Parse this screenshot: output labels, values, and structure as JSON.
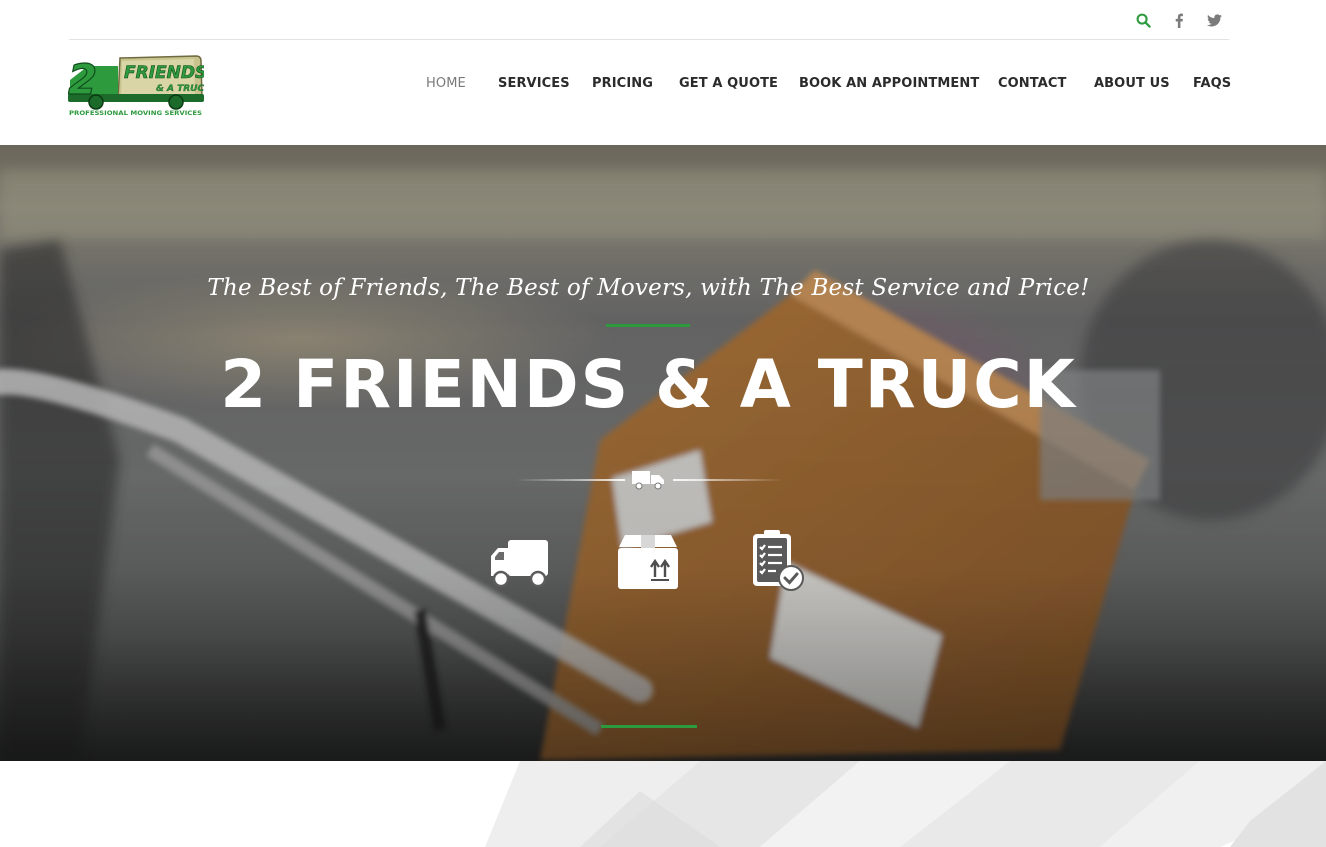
{
  "brand": {
    "logo_alt": "2 Friends & A Truck - Professional Moving Services",
    "logo_number": "2",
    "logo_word": "FRIENDS",
    "logo_sub": "& A TRUCK",
    "logo_tagline": "PROFESSIONAL MOVING SERVICES",
    "color_green": "#2e9a3e",
    "color_dark_green": "#1c6b2a"
  },
  "topbar": {
    "icons": [
      "search-icon",
      "facebook-icon",
      "twitter-icon"
    ]
  },
  "nav": {
    "items": [
      {
        "label": "HOME",
        "active": true
      },
      {
        "label": "SERVICES",
        "active": false
      },
      {
        "label": "PRICING",
        "active": false
      },
      {
        "label": "GET A QUOTE",
        "active": false
      },
      {
        "label": "BOOK AN APPOINTMENT",
        "active": false
      },
      {
        "label": "CONTACT",
        "active": false
      },
      {
        "label": "ABOUT US",
        "active": false
      },
      {
        "label": "FAQS",
        "active": false
      }
    ]
  },
  "hero": {
    "tagline": "The Best of Friends, The Best of Movers, with The Best Service and Price!",
    "headline": "2 FRIENDS & A TRUCK",
    "feature_icons": [
      "truck-icon",
      "box-icon",
      "clipboard-check-icon"
    ]
  }
}
